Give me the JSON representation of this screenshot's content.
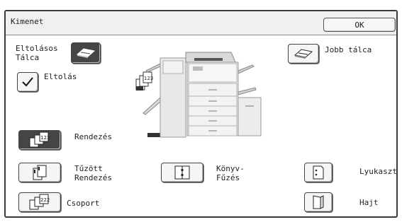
{
  "window": {
    "title": "Kimenet",
    "ok_label": "OK"
  },
  "left_tray": {
    "label_line1": "Eltolásos",
    "label_line2": "Tálca",
    "icon": "tray-icon"
  },
  "offset": {
    "label": "Eltolás",
    "checked": true
  },
  "right_tray": {
    "label": "Jobb tálca",
    "icon": "tray-icon"
  },
  "modes": {
    "sort": {
      "label": "Rendezés",
      "selected": true
    },
    "staple_sort": {
      "label_line1": "Tűzött",
      "label_line2": "Rendezés"
    },
    "group": {
      "label": "Csoport"
    },
    "saddle_stitch": {
      "label_line1": "Könyv-",
      "label_line2": "Fűzés"
    },
    "punch": {
      "label": "Lyukaszt"
    },
    "fold": {
      "label": "Hajt"
    }
  },
  "colors": {
    "selected_button": "#454545",
    "border": "#3a3a3a",
    "titlebar": "#f0f0f0"
  }
}
